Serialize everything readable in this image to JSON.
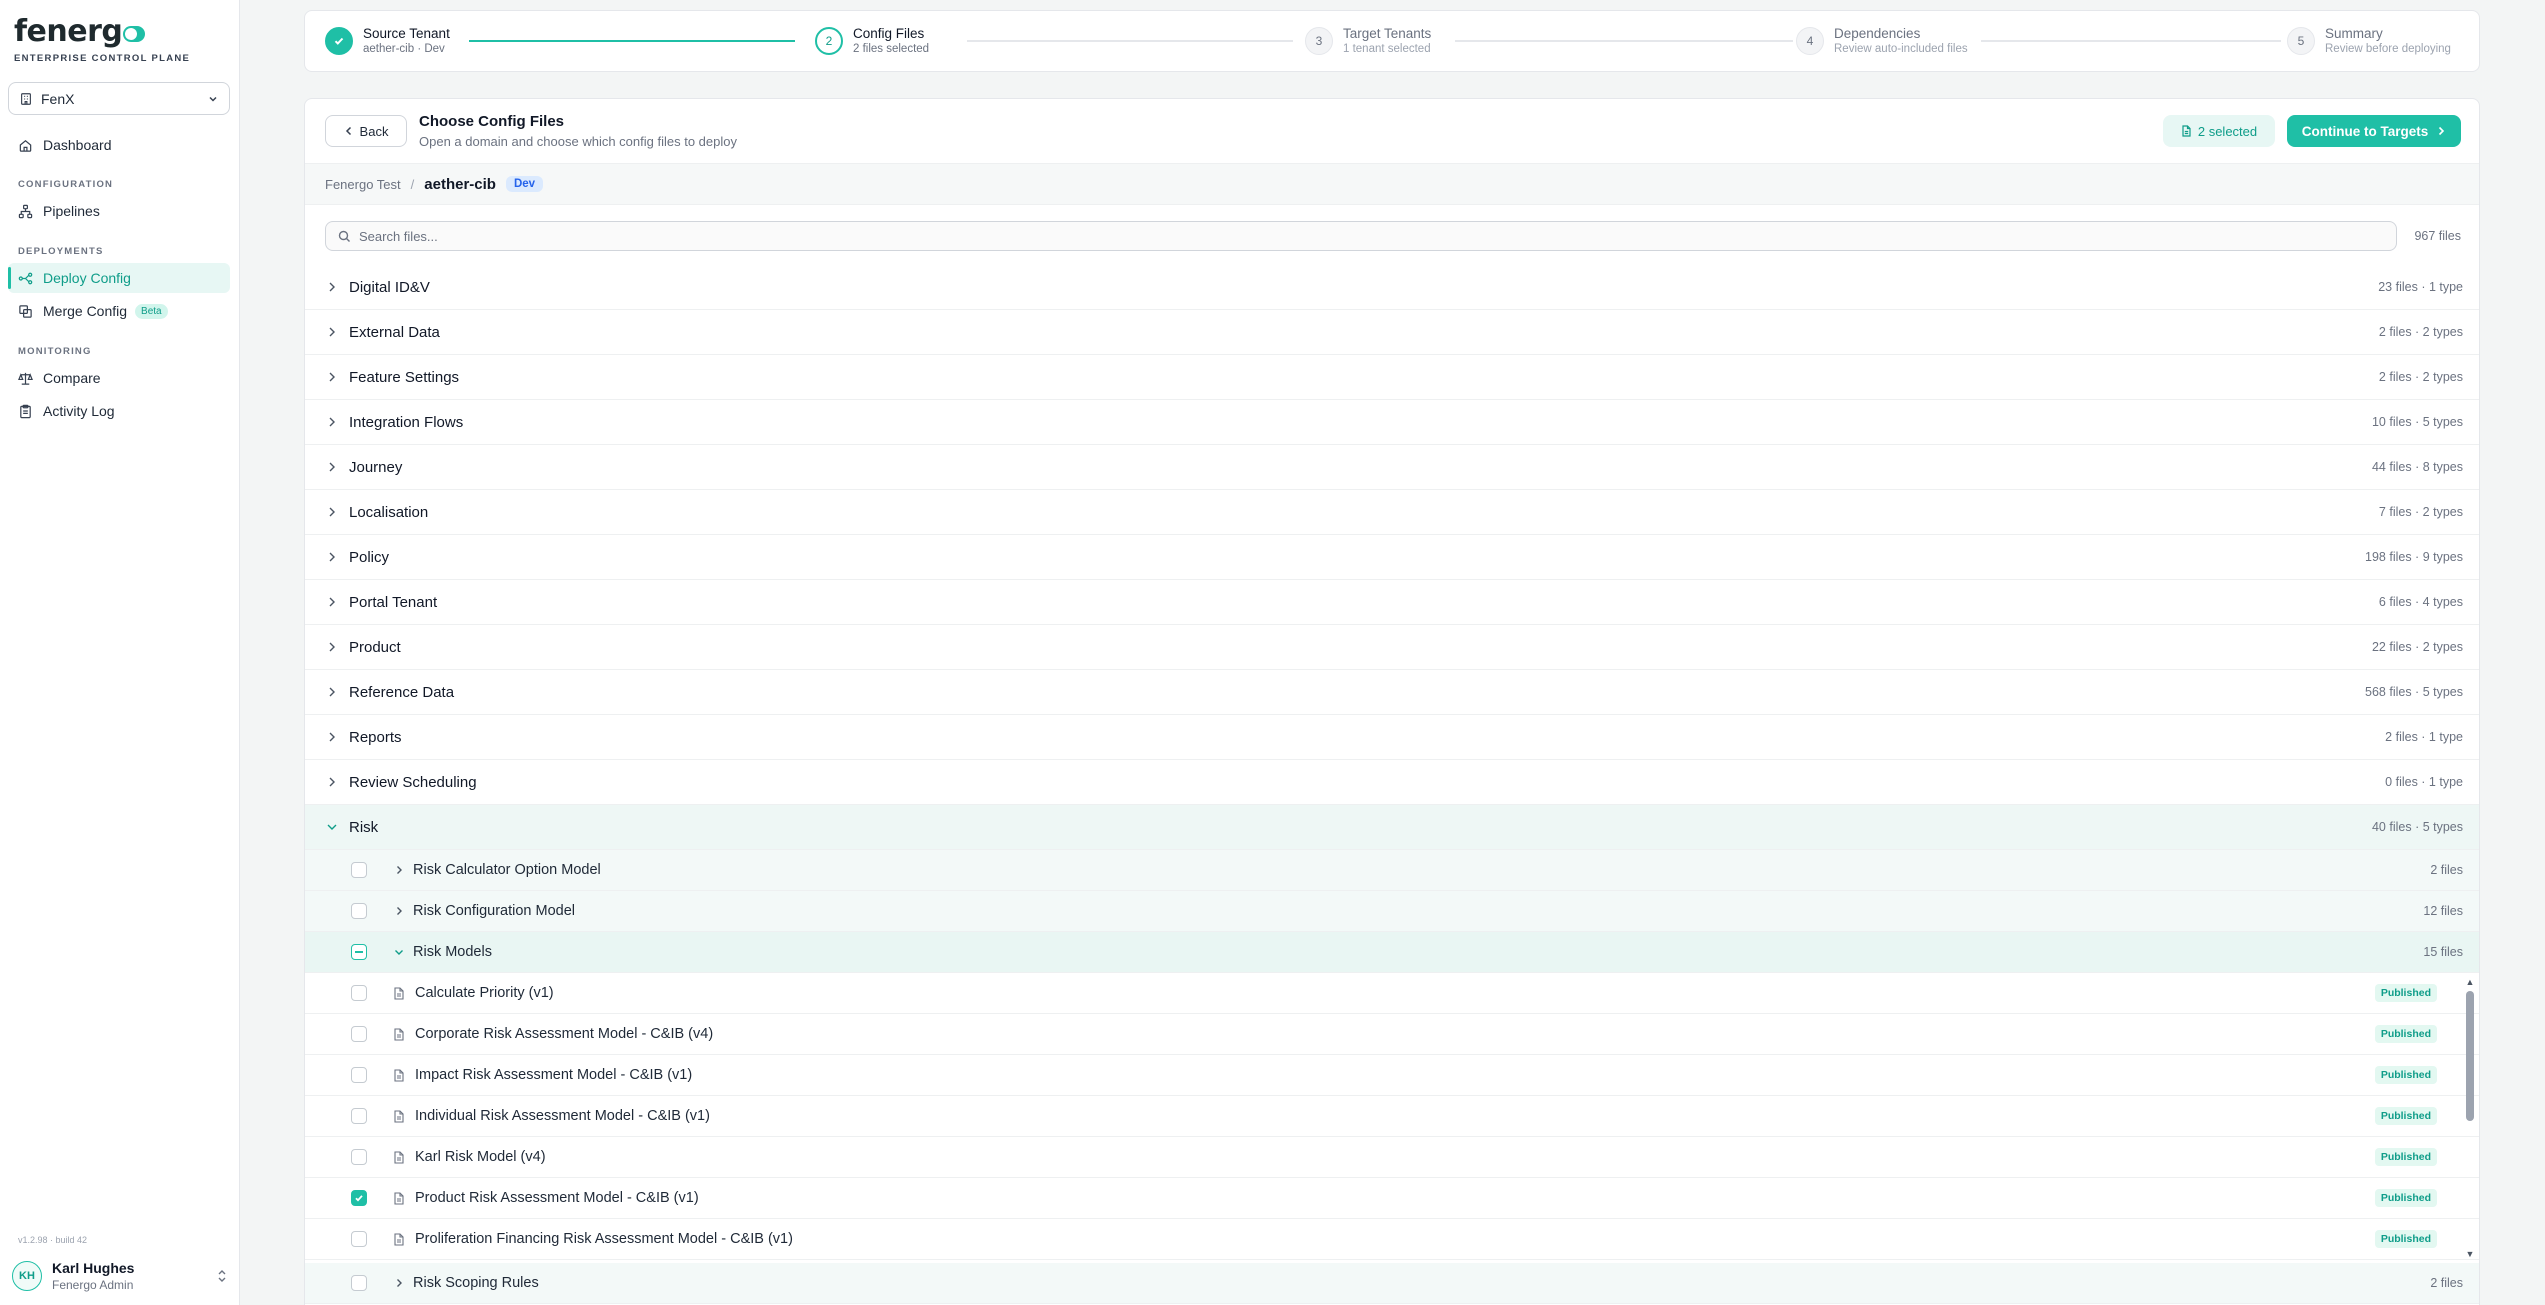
{
  "app": {
    "logo": "fenerg",
    "subtitle": "ENTERPRISE CONTROL PLANE",
    "tenant": "FenX",
    "version": "v1.2.98 · build 42"
  },
  "nav": {
    "dashboard": "Dashboard",
    "section_configuration": "CONFIGURATION",
    "pipelines": "Pipelines",
    "section_deployments": "DEPLOYMENTS",
    "deploy_config": "Deploy Config",
    "merge_config": "Merge Config",
    "beta": "Beta",
    "section_monitoring": "MONITORING",
    "compare": "Compare",
    "activity_log": "Activity Log"
  },
  "user": {
    "initials": "KH",
    "name": "Karl Hughes",
    "role": "Fenergo Admin"
  },
  "steps": [
    {
      "num": "1",
      "title": "Source Tenant",
      "sub": "aether-cib · Dev",
      "state": "done"
    },
    {
      "num": "2",
      "title": "Config Files",
      "sub": "2 files selected",
      "state": "current"
    },
    {
      "num": "3",
      "title": "Target Tenants",
      "sub": "1 tenant selected",
      "state": "future"
    },
    {
      "num": "4",
      "title": "Dependencies",
      "sub": "Review auto-included files",
      "state": "future"
    },
    {
      "num": "5",
      "title": "Summary",
      "sub": "Review before deploying",
      "state": "future"
    }
  ],
  "header": {
    "back": "Back",
    "title": "Choose Config Files",
    "subtitle": "Open a domain and choose which config files to deploy",
    "selected": "2 selected",
    "continue": "Continue to Targets"
  },
  "breadcrumb": {
    "root": "Fenergo Test",
    "sep": "/",
    "current": "aether-cib",
    "env": "Dev"
  },
  "search": {
    "placeholder": "Search files...",
    "count": "967 files"
  },
  "domains": [
    {
      "name": "Digital ID&V",
      "meta": "23 files · 1 type"
    },
    {
      "name": "External Data",
      "meta": "2 files · 2 types"
    },
    {
      "name": "Feature Settings",
      "meta": "2 files · 2 types"
    },
    {
      "name": "Integration Flows",
      "meta": "10 files · 5 types"
    },
    {
      "name": "Journey",
      "meta": "44 files · 8 types"
    },
    {
      "name": "Localisation",
      "meta": "7 files · 2 types"
    },
    {
      "name": "Policy",
      "meta": "198 files · 9 types"
    },
    {
      "name": "Portal Tenant",
      "meta": "6 files · 4 types"
    },
    {
      "name": "Product",
      "meta": "22 files · 2 types"
    },
    {
      "name": "Reference Data",
      "meta": "568 files · 5 types"
    },
    {
      "name": "Reports",
      "meta": "2 files · 1 type"
    },
    {
      "name": "Review Scheduling",
      "meta": "0 files · 1 type"
    }
  ],
  "risk": {
    "name": "Risk",
    "meta": "40 files · 5 types",
    "types_before": [
      {
        "name": "Risk Calculator Option Model",
        "meta": "2 files"
      },
      {
        "name": "Risk Configuration Model",
        "meta": "12 files"
      }
    ],
    "open_type": {
      "name": "Risk Models",
      "meta": "15 files"
    },
    "files": [
      {
        "name": "Calculate Priority (v1)",
        "status": "Published",
        "checked": false
      },
      {
        "name": "Corporate Risk Assessment Model - C&IB (v4)",
        "status": "Published",
        "checked": false
      },
      {
        "name": "Impact Risk Assessment Model - C&IB (v1)",
        "status": "Published",
        "checked": false
      },
      {
        "name": "Individual Risk Assessment Model - C&IB (v1)",
        "status": "Published",
        "checked": false
      },
      {
        "name": "Karl Risk Model (v4)",
        "status": "Published",
        "checked": false
      },
      {
        "name": "Product Risk Assessment Model - C&IB (v1)",
        "status": "Published",
        "checked": true
      },
      {
        "name": "Proliferation Financing Risk Assessment Model - C&IB (v1)",
        "status": "Published",
        "checked": false
      }
    ],
    "types_after": [
      {
        "name": "Risk Scoping Rules",
        "meta": "2 files"
      }
    ]
  },
  "colors": {
    "accent": "#1fbfa6",
    "accent_dark": "#0f9d89",
    "env_badge": "#2563eb"
  }
}
